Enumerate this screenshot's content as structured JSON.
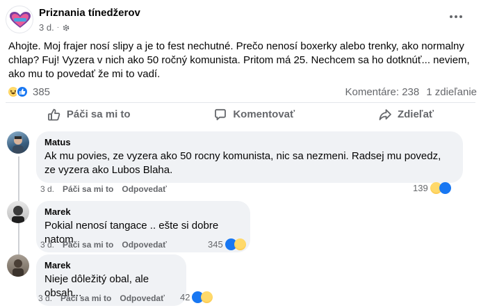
{
  "post": {
    "page_name": "Priznania tínedžerov",
    "time": "3 d.",
    "text": "Ahojte. Moj frajer nosí slipy a je to fest nechutné. Prečo nenosí boxerky alebo trenky, ako normalny chlap? Fuj! Vyzera v nich ako 50 ročný komunista. Pritom má 25. Nechcem sa ho dotknúť... neviem, ako mu to povedať že mi to vadí.",
    "reaction_count": "385",
    "comments_count": "Komentáre: 238",
    "shares_count": "1 zdieľanie"
  },
  "actions": {
    "like": "Páči sa mi to",
    "comment": "Komentovať",
    "share": "Zdieľať"
  },
  "comments": [
    {
      "name": "Matus",
      "text": "Ak mu povies, ze vyzera ako 50 rocny komunista, nic sa nezmeni. Radsej mu povedz, ze vyzera ako Lubos Blaha.",
      "time": "3 d.",
      "like_label": "Páči sa mi to",
      "reply_label": "Odpovedať",
      "reactions": "139"
    },
    {
      "name": "Marek",
      "text": "Pokial nenosí tangace .. ešte si dobre natom",
      "time": "3 d.",
      "like_label": "Páči sa mi to",
      "reply_label": "Odpovedať",
      "reactions": "345"
    },
    {
      "name": "Marek",
      "text": "Nieje dôležitý obal, ale obsah...",
      "time": "3 d.",
      "like_label": "Páči sa mi to",
      "reply_label": "Odpovedať",
      "reactions": "42"
    }
  ],
  "colors": {
    "accent": "#1877f2",
    "secondary_text": "#65676b",
    "bubble": "#f0f2f5",
    "haha": "#f7b125"
  }
}
